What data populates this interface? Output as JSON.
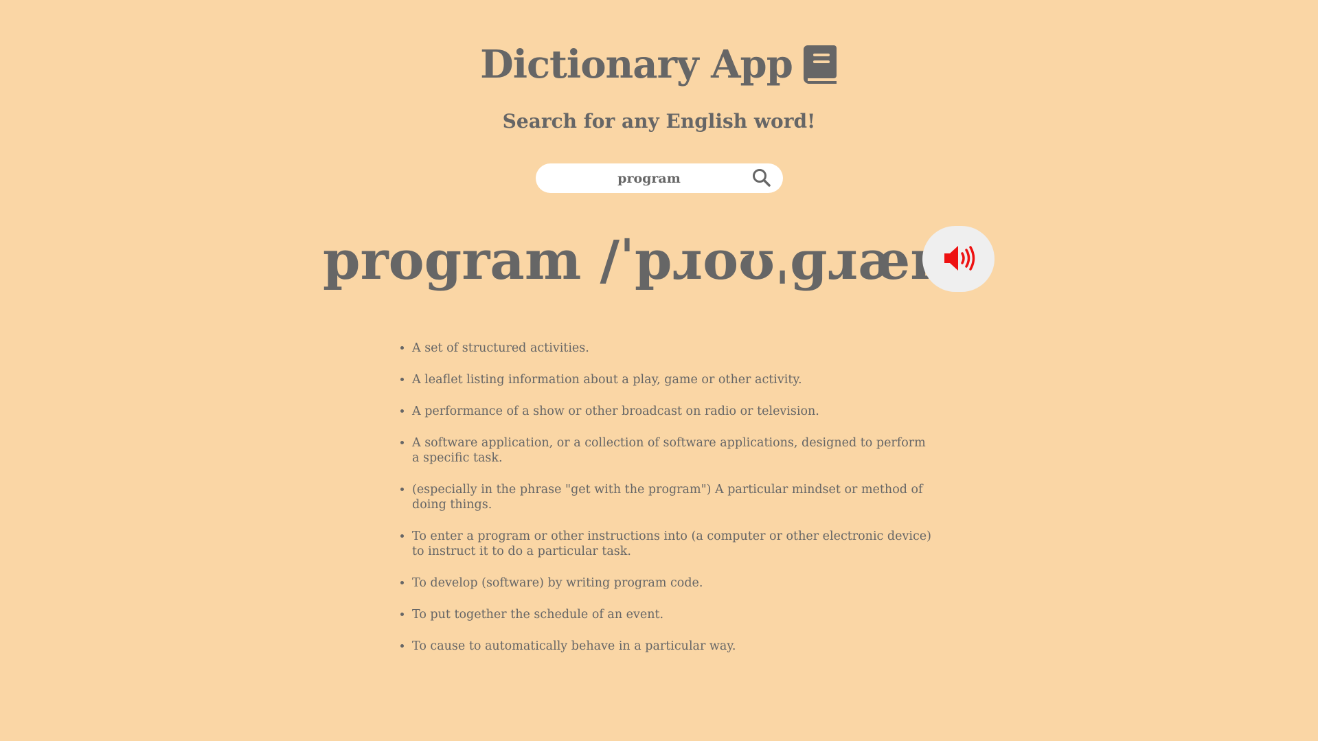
{
  "header": {
    "title": "Dictionary App",
    "icon": "book-icon",
    "subtitle": "Search for any English word!"
  },
  "search": {
    "value": "program",
    "icon": "search-icon"
  },
  "result": {
    "heading": "program /ˈpɹoʊˌɡɹæm/",
    "audio_icon": "volume-up-icon",
    "audio_icon_color": "#ee1111",
    "definitions": [
      "A set of structured activities.",
      "A leaflet listing information about a play, game or other activity.",
      "A performance of a show or other broadcast on radio or television.",
      "A software application, or a collection of software applications, designed to perform a specific task.",
      "(especially in the phrase \"get with the program\") A particular mindset or method of doing things.",
      "To enter a program or other instructions into (a computer or other electronic device) to instruct it to do a particular task.",
      "To develop (software) by writing program code.",
      "To put together the schedule of an event.",
      "To cause to automatically behave in a particular way."
    ]
  },
  "colors": {
    "background": "#fad6a5",
    "text": "#666666",
    "search_bg": "#ffffff",
    "audio_button_bg": "#efefef"
  }
}
